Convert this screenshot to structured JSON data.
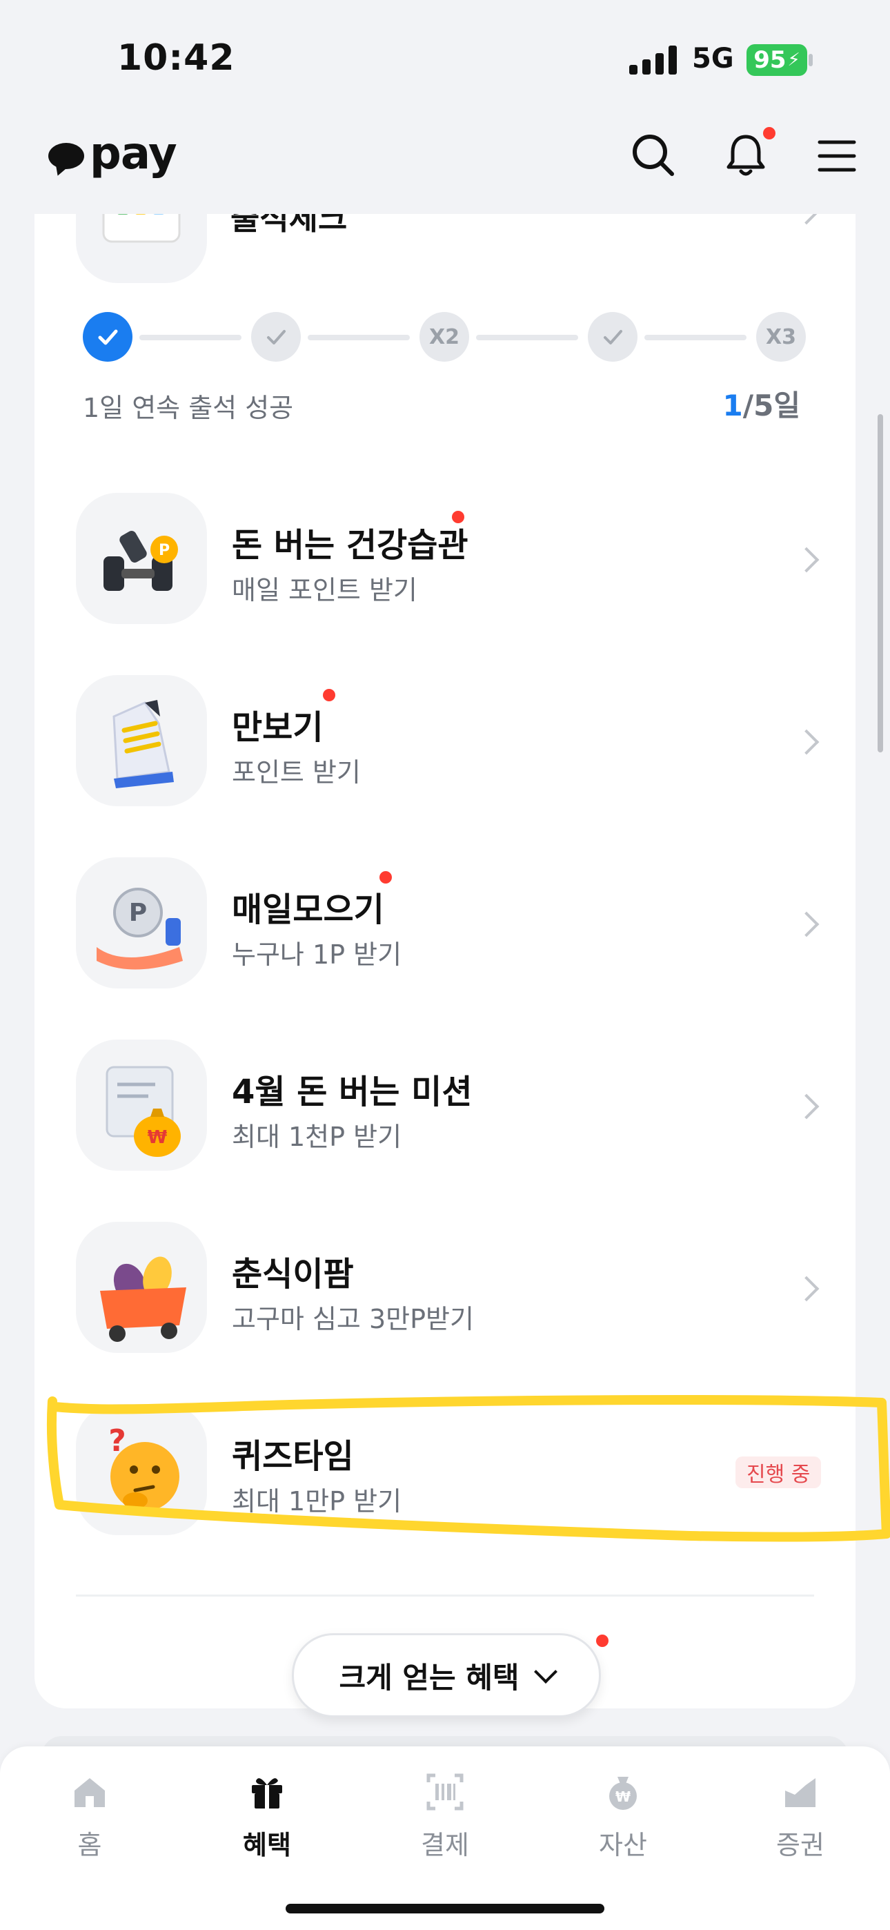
{
  "status_bar": {
    "time": "10:42",
    "network": "5G",
    "battery": "95"
  },
  "header": {
    "logo_text": "pay"
  },
  "attendance": {
    "title": "출석체크",
    "steps": [
      {
        "state": "done",
        "label": ""
      },
      {
        "state": "check",
        "label": ""
      },
      {
        "state": "bonus",
        "label": "X2"
      },
      {
        "state": "check",
        "label": ""
      },
      {
        "state": "bonus",
        "label": "X3"
      }
    ],
    "streak_text": "1일 연속 출석 성공",
    "current_day": "1",
    "total_days": "/5일"
  },
  "items": [
    {
      "title": "돈 버는 건강습관",
      "subtitle": "매일 포인트 받기",
      "new_dot": true
    },
    {
      "title": "만보기",
      "subtitle": "포인트 받기",
      "new_dot": true
    },
    {
      "title": "매일모으기",
      "subtitle": "누구나 1P 받기",
      "new_dot": true
    },
    {
      "title": "4월 돈 버는 미션",
      "subtitle": "최대 1천P 받기",
      "new_dot": false
    },
    {
      "title": "춘식이팜",
      "subtitle": "고구마 심고 3만P받기",
      "new_dot": false
    },
    {
      "title": "퀴즈타임",
      "subtitle": "최대 1만P 받기",
      "new_dot": false,
      "badge": "진행 중"
    }
  ],
  "more_button": {
    "label": "크게 얻는 혜택"
  },
  "bottom_nav": [
    {
      "label": "홈",
      "icon": "home-icon",
      "active": false
    },
    {
      "label": "혜택",
      "icon": "gift-icon",
      "active": true
    },
    {
      "label": "결제",
      "icon": "barcode-scan-icon",
      "active": false
    },
    {
      "label": "자산",
      "icon": "money-bag-icon",
      "active": false
    },
    {
      "label": "증권",
      "icon": "chart-icon",
      "active": false
    }
  ],
  "colors": {
    "accent": "#1a7df0",
    "red_dot": "#ff3b30",
    "highlight": "#ffd62e",
    "badge_text": "#e5484d"
  }
}
